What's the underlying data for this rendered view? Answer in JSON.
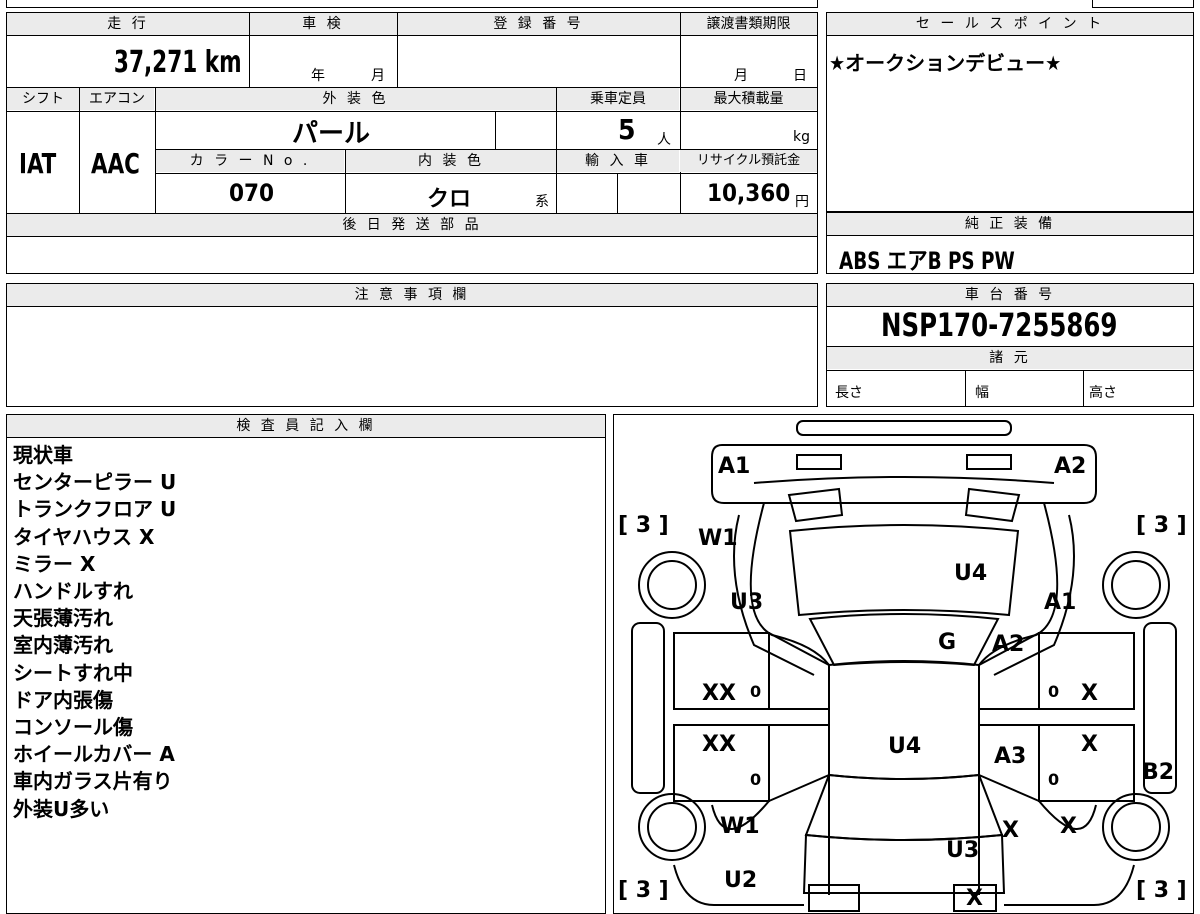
{
  "headers": {
    "mileage": "走 行",
    "inspection": "車 検",
    "registration": "登 録 番 号",
    "transfer_deadline": "譲渡書類期限",
    "sales_point": "セ ー ル ス ポ イ ン ト",
    "shift": "シフト",
    "aircon": "エアコン",
    "exterior_color": "外 装 色",
    "capacity": "乗車定員",
    "max_load": "最大積載量",
    "color_no": "カ ラ ー N o .",
    "interior_color": "内 装 色",
    "imported": "輸 入 車",
    "recycle_fee": "リサイクル預託金",
    "later_parts": "後 日 発 送 部 品",
    "equipment": "純 正 装 備",
    "notes_caution": "注 意 事 項 欄",
    "chassis_number": "車 台 番 号",
    "specs": "諸 元",
    "inspector_notes": "検 査 員 記 入 欄"
  },
  "values": {
    "mileage": "37,271 km",
    "year_unit": "年",
    "month_unit": "月",
    "deadline_month": "月",
    "deadline_day": "日",
    "sales_point": "★オークションデビュー★",
    "shift": "IAT",
    "aircon": "AAC",
    "exterior_color": "パール",
    "capacity": "5",
    "capacity_unit": "人",
    "load_unit": "kg",
    "color_no": "070",
    "interior_color": "クロ",
    "interior_suffix": "系",
    "recycle_fee": "10,360",
    "yen": "円",
    "equipment": "ABS エアB PS PW",
    "chassis_number": "NSP170-7255869",
    "spec_length": "長さ",
    "spec_width": "幅",
    "spec_height": "高さ"
  },
  "inspector_notes": [
    "現状車",
    "センターピラー U",
    "トランクフロア U",
    "タイヤハウス X",
    "ミラー X",
    "ハンドルすれ",
    "天張薄汚れ",
    "室内薄汚れ",
    "シートすれ中",
    "ドア内張傷",
    "コンソール傷",
    "ホイールカバー A",
    "車内ガラス片有り",
    "外装U多い"
  ],
  "diagram_marks": {
    "front_left": "A1",
    "front_right": "A2",
    "tread_fl": "[ 3 ]",
    "tread_fr": "[ 3 ]",
    "tread_rl": "[ 3 ]",
    "tread_rr": "[ 3 ]",
    "fender_fl": "W1",
    "fender_fl2": "U3",
    "bonnet": "U4",
    "fender_fr": "A1",
    "windshield": "G",
    "pillar_r": "A2",
    "door_fl": "XX",
    "door_rl": "XX",
    "door_fr": "X",
    "door_rr": "X",
    "roof": "U4",
    "side_r": "A3",
    "rear_panel_r": "B2",
    "fender_rl": "W1",
    "rear_l": "U2",
    "trunk": "U3",
    "quarter_r": "X",
    "quarter_r2": "X",
    "bumper_r": "X",
    "zero": "0"
  }
}
